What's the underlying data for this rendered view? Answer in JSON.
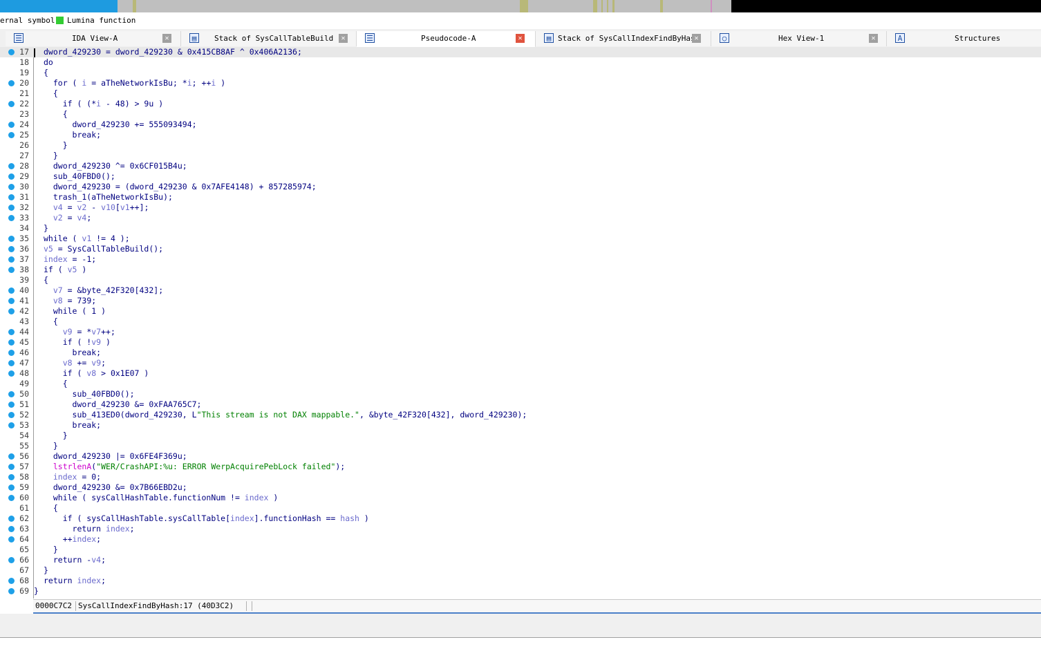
{
  "legend": {
    "external_label": "ernal symbol",
    "lumina_label": "Lumina function",
    "lumina_color": "#33cc33"
  },
  "navbar": {
    "colors": {
      "library": "#1e9be0",
      "data": "#bfbfbf",
      "unexplored": "#000000",
      "marker": "#b8b878"
    }
  },
  "tabs": [
    {
      "label": "IDA View-A",
      "icon": "ida-view-icon",
      "active": false,
      "closable": true
    },
    {
      "label": "Stack of SysCallTableBuild",
      "icon": "stack-icon",
      "active": false,
      "closable": true
    },
    {
      "label": "Pseudocode-A",
      "icon": "pseudocode-icon",
      "active": true,
      "closable": true
    },
    {
      "label": "Stack of SysCallIndexFindByHash",
      "icon": "stack-icon",
      "active": false,
      "closable": true
    },
    {
      "label": "Hex View-1",
      "icon": "hex-view-icon",
      "active": false,
      "closable": true
    },
    {
      "label": "Structures",
      "icon": "structures-icon",
      "active": false,
      "closable": false
    }
  ],
  "code": {
    "lines": [
      {
        "n": "17",
        "dot": true,
        "tokens": [
          [
            "n",
            "dword_429230 = dword_429230 & 0x415CB8AF ^ 0x406A2136;"
          ]
        ]
      },
      {
        "n": "18",
        "dot": false,
        "tokens": [
          [
            "n",
            "do"
          ]
        ]
      },
      {
        "n": "19",
        "dot": false,
        "tokens": [
          [
            "n",
            "{"
          ]
        ]
      },
      {
        "n": "20",
        "dot": true,
        "tokens": [
          [
            "n",
            "  for ( "
          ],
          [
            "v",
            "i"
          ],
          [
            "n",
            " = aTheNetworkIsBu; *"
          ],
          [
            "v",
            "i"
          ],
          [
            "n",
            "; ++"
          ],
          [
            "v",
            "i"
          ],
          [
            "n",
            " )"
          ]
        ]
      },
      {
        "n": "21",
        "dot": false,
        "tokens": [
          [
            "n",
            "  {"
          ]
        ]
      },
      {
        "n": "22",
        "dot": true,
        "tokens": [
          [
            "n",
            "    if ( (*"
          ],
          [
            "v",
            "i"
          ],
          [
            "n",
            " - 48) > 9u )"
          ]
        ]
      },
      {
        "n": "23",
        "dot": false,
        "tokens": [
          [
            "n",
            "    {"
          ]
        ]
      },
      {
        "n": "24",
        "dot": true,
        "tokens": [
          [
            "n",
            "      dword_429230 += 555093494;"
          ]
        ]
      },
      {
        "n": "25",
        "dot": true,
        "tokens": [
          [
            "n",
            "      break;"
          ]
        ]
      },
      {
        "n": "26",
        "dot": false,
        "tokens": [
          [
            "n",
            "    }"
          ]
        ]
      },
      {
        "n": "27",
        "dot": false,
        "tokens": [
          [
            "n",
            "  }"
          ]
        ]
      },
      {
        "n": "28",
        "dot": true,
        "tokens": [
          [
            "n",
            "  dword_429230 ^= 0x6CF015B4u;"
          ]
        ]
      },
      {
        "n": "29",
        "dot": true,
        "tokens": [
          [
            "n",
            "  sub_40FBD0();"
          ]
        ]
      },
      {
        "n": "30",
        "dot": true,
        "tokens": [
          [
            "n",
            "  dword_429230 = (dword_429230 & 0x7AFE4148) + 857285974;"
          ]
        ]
      },
      {
        "n": "31",
        "dot": true,
        "tokens": [
          [
            "n",
            "  trash_1(aTheNetworkIsBu);"
          ]
        ]
      },
      {
        "n": "32",
        "dot": true,
        "tokens": [
          [
            "n",
            "  "
          ],
          [
            "v",
            "v4"
          ],
          [
            "n",
            " = "
          ],
          [
            "v",
            "v2"
          ],
          [
            "n",
            " - "
          ],
          [
            "v",
            "v10"
          ],
          [
            "n",
            "["
          ],
          [
            "v",
            "v1"
          ],
          [
            "n",
            "++];"
          ]
        ]
      },
      {
        "n": "33",
        "dot": true,
        "tokens": [
          [
            "n",
            "  "
          ],
          [
            "v",
            "v2"
          ],
          [
            "n",
            " = "
          ],
          [
            "v",
            "v4"
          ],
          [
            "n",
            ";"
          ]
        ]
      },
      {
        "n": "34",
        "dot": false,
        "tokens": [
          [
            "n",
            "}"
          ]
        ]
      },
      {
        "n": "35",
        "dot": true,
        "tokens": [
          [
            "n",
            "while ( "
          ],
          [
            "v",
            "v1"
          ],
          [
            "n",
            " != 4 );"
          ]
        ]
      },
      {
        "n": "36",
        "dot": true,
        "tokens": [
          [
            "v",
            "v5"
          ],
          [
            "n",
            " = SysCallTableBuild();"
          ]
        ]
      },
      {
        "n": "37",
        "dot": true,
        "tokens": [
          [
            "v",
            "index"
          ],
          [
            "n",
            " = -1;"
          ]
        ]
      },
      {
        "n": "38",
        "dot": true,
        "tokens": [
          [
            "n",
            "if ( "
          ],
          [
            "v",
            "v5"
          ],
          [
            "n",
            " )"
          ]
        ]
      },
      {
        "n": "39",
        "dot": false,
        "tokens": [
          [
            "n",
            "{"
          ]
        ]
      },
      {
        "n": "40",
        "dot": true,
        "tokens": [
          [
            "n",
            "  "
          ],
          [
            "v",
            "v7"
          ],
          [
            "n",
            " = &byte_42F320[432];"
          ]
        ]
      },
      {
        "n": "41",
        "dot": true,
        "tokens": [
          [
            "n",
            "  "
          ],
          [
            "v",
            "v8"
          ],
          [
            "n",
            " = 739;"
          ]
        ]
      },
      {
        "n": "42",
        "dot": true,
        "tokens": [
          [
            "n",
            "  while ( 1 )"
          ]
        ]
      },
      {
        "n": "43",
        "dot": false,
        "tokens": [
          [
            "n",
            "  {"
          ]
        ]
      },
      {
        "n": "44",
        "dot": true,
        "tokens": [
          [
            "n",
            "    "
          ],
          [
            "v",
            "v9"
          ],
          [
            "n",
            " = *"
          ],
          [
            "v",
            "v7"
          ],
          [
            "n",
            "++;"
          ]
        ]
      },
      {
        "n": "45",
        "dot": true,
        "tokens": [
          [
            "n",
            "    if ( !"
          ],
          [
            "v",
            "v9"
          ],
          [
            "n",
            " )"
          ]
        ]
      },
      {
        "n": "46",
        "dot": true,
        "tokens": [
          [
            "n",
            "      break;"
          ]
        ]
      },
      {
        "n": "47",
        "dot": true,
        "tokens": [
          [
            "n",
            "    "
          ],
          [
            "v",
            "v8"
          ],
          [
            "n",
            " += "
          ],
          [
            "v",
            "v9"
          ],
          [
            "n",
            ";"
          ]
        ]
      },
      {
        "n": "48",
        "dot": true,
        "tokens": [
          [
            "n",
            "    if ( "
          ],
          [
            "v",
            "v8"
          ],
          [
            "n",
            " > 0x1E07 )"
          ]
        ]
      },
      {
        "n": "49",
        "dot": false,
        "tokens": [
          [
            "n",
            "    {"
          ]
        ]
      },
      {
        "n": "50",
        "dot": true,
        "tokens": [
          [
            "n",
            "      sub_40FBD0();"
          ]
        ]
      },
      {
        "n": "51",
        "dot": true,
        "tokens": [
          [
            "n",
            "      dword_429230 &= 0xFAA765C7;"
          ]
        ]
      },
      {
        "n": "52",
        "dot": true,
        "tokens": [
          [
            "n",
            "      sub_413ED0(dword_429230, L"
          ],
          [
            "s",
            "\"This stream is not DAX mappable.\""
          ],
          [
            "n",
            ", &byte_42F320[432], dword_429230);"
          ]
        ]
      },
      {
        "n": "53",
        "dot": true,
        "tokens": [
          [
            "n",
            "      break;"
          ]
        ]
      },
      {
        "n": "54",
        "dot": false,
        "tokens": [
          [
            "n",
            "    }"
          ]
        ]
      },
      {
        "n": "55",
        "dot": false,
        "tokens": [
          [
            "n",
            "  }"
          ]
        ]
      },
      {
        "n": "56",
        "dot": true,
        "tokens": [
          [
            "n",
            "  dword_429230 |= 0x6FE4F369u;"
          ]
        ]
      },
      {
        "n": "57",
        "dot": true,
        "tokens": [
          [
            "n",
            "  "
          ],
          [
            "i",
            "lstrlenA"
          ],
          [
            "n",
            "("
          ],
          [
            "s",
            "\"WER/CrashAPI:%u: ERROR WerpAcquirePebLock failed\""
          ],
          [
            "n",
            ");"
          ]
        ]
      },
      {
        "n": "58",
        "dot": true,
        "tokens": [
          [
            "n",
            "  "
          ],
          [
            "v",
            "index"
          ],
          [
            "n",
            " = 0;"
          ]
        ]
      },
      {
        "n": "59",
        "dot": true,
        "tokens": [
          [
            "n",
            "  dword_429230 &= 0x7B66EBD2u;"
          ]
        ]
      },
      {
        "n": "60",
        "dot": true,
        "tokens": [
          [
            "n",
            "  while ( sysCallHashTable.functionNum != "
          ],
          [
            "v",
            "index"
          ],
          [
            "n",
            " )"
          ]
        ]
      },
      {
        "n": "61",
        "dot": false,
        "tokens": [
          [
            "n",
            "  {"
          ]
        ]
      },
      {
        "n": "62",
        "dot": true,
        "tokens": [
          [
            "n",
            "    if ( sysCallHashTable.sysCallTable["
          ],
          [
            "v",
            "index"
          ],
          [
            "n",
            "].functionHash == "
          ],
          [
            "v",
            "hash"
          ],
          [
            "n",
            " )"
          ]
        ]
      },
      {
        "n": "63",
        "dot": true,
        "tokens": [
          [
            "n",
            "      return "
          ],
          [
            "v",
            "index"
          ],
          [
            "n",
            ";"
          ]
        ]
      },
      {
        "n": "64",
        "dot": true,
        "tokens": [
          [
            "n",
            "    ++"
          ],
          [
            "v",
            "index"
          ],
          [
            "n",
            ";"
          ]
        ]
      },
      {
        "n": "65",
        "dot": false,
        "tokens": [
          [
            "n",
            "  }"
          ]
        ]
      },
      {
        "n": "66",
        "dot": true,
        "tokens": [
          [
            "n",
            "  return -"
          ],
          [
            "v",
            "v4"
          ],
          [
            "n",
            ";"
          ]
        ]
      },
      {
        "n": "67",
        "dot": false,
        "tokens": [
          [
            "n",
            "}"
          ]
        ]
      },
      {
        "n": "68",
        "dot": true,
        "tokens": [
          [
            "n",
            "return "
          ],
          [
            "v",
            "index"
          ],
          [
            "n",
            ";"
          ]
        ]
      },
      {
        "n": "69",
        "dot": true,
        "tokens": [
          [
            "n",
            "}"
          ]
        ],
        "shift": true
      }
    ],
    "current_line": "17"
  },
  "status": {
    "offset": "0000C7C2",
    "location": "SysCallIndexFindByHash:17 (40D3C2)"
  }
}
